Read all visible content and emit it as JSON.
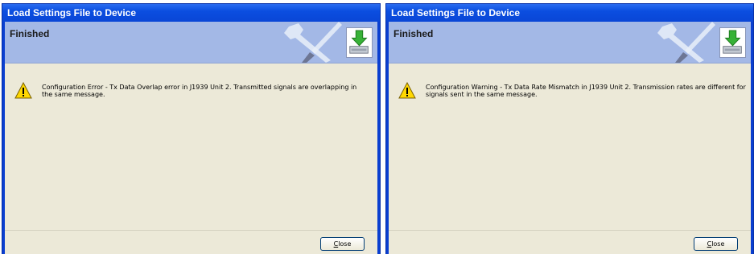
{
  "colors": {
    "titlebar": "#0a46d6",
    "banner": "#a3b8e6",
    "client": "#ece9d8",
    "accent_green": "#2fa12f",
    "warning_yellow": "#ffd800"
  },
  "dialogs": [
    {
      "title": "Load Settings File to Device",
      "banner_title": "Finished",
      "message_line1": "Configuration Error - Tx Data Overlap error in J1939 Unit 2.  Transmitted signals are overlapping in",
      "message_line2": "the same message.",
      "close_mnemonic": "C",
      "close_rest": "lose",
      "icons": {
        "banner": "wrench-screwdriver-icon",
        "device": "device-download-icon",
        "message": "warning-icon"
      }
    },
    {
      "title": "Load Settings File to Device",
      "banner_title": "Finished",
      "message_line1": "Configuration Warning - Tx Data Rate Mismatch in J1939 Unit 2. Transmission rates are different for",
      "message_line2": "signals sent in the same message.",
      "close_mnemonic": "C",
      "close_rest": "lose",
      "icons": {
        "banner": "wrench-screwdriver-icon",
        "device": "device-download-icon",
        "message": "warning-icon"
      }
    }
  ]
}
